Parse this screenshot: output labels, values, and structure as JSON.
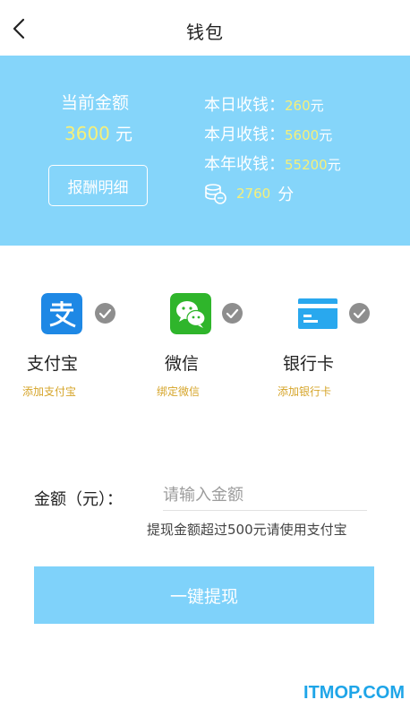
{
  "header": {
    "title": "钱包",
    "back_icon": "chevron-left-icon"
  },
  "summary": {
    "current_label": "当前金额",
    "current_amount": "3600",
    "current_unit": "元",
    "detail_button": "报酬明细",
    "today_label": "本日收钱：",
    "today_value": "260",
    "month_label": "本月收钱：",
    "month_value": "5600",
    "year_label": "本年收钱：",
    "year_value": "55200",
    "unit": "元",
    "points_value": "2760",
    "points_unit": "分",
    "points_icon": "coins-icon"
  },
  "payment_methods": [
    {
      "name": "支付宝",
      "action": "添加支付宝",
      "icon": "alipay-icon",
      "icon_color": "#1e88e5"
    },
    {
      "name": "微信",
      "action": "绑定微信",
      "icon": "wechat-icon",
      "icon_color": "#2fb52b"
    },
    {
      "name": "银行卡",
      "action": "添加银行卡",
      "icon": "bank-card-icon",
      "icon_color": "#29a8ee"
    }
  ],
  "amount": {
    "label": "金额（元）：",
    "placeholder": "请输入金额",
    "hint": "提现金额超过500元请使用支付宝"
  },
  "withdraw_button": "一键提现",
  "watermark": "ITMOP.COM",
  "colors": {
    "panel_bg": "#85d5fa",
    "highlight": "#f6f07a",
    "link": "#d6a52a",
    "button_bg": "#7fd2fa"
  }
}
